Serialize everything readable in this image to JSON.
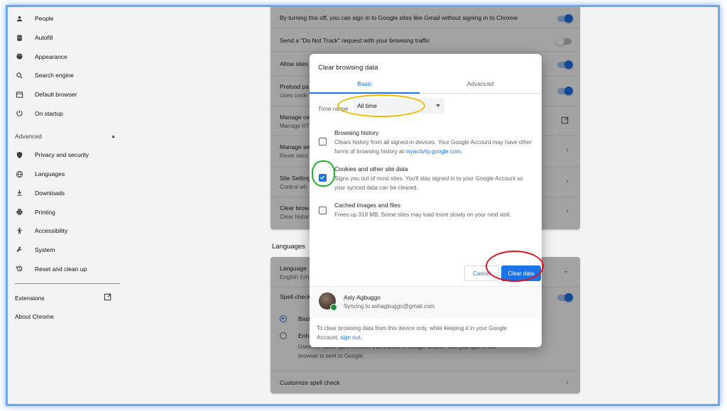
{
  "sidebar": {
    "items": [
      {
        "label": "People",
        "icon": "person-icon"
      },
      {
        "label": "Autofill",
        "icon": "clipboard-icon"
      },
      {
        "label": "Appearance",
        "icon": "palette-icon"
      },
      {
        "label": "Search engine",
        "icon": "search-icon"
      },
      {
        "label": "Default browser",
        "icon": "browser-icon"
      },
      {
        "label": "On startup",
        "icon": "power-icon"
      }
    ],
    "advanced_label": "Advanced",
    "advanced_items": [
      {
        "label": "Privacy and security",
        "icon": "shield-icon"
      },
      {
        "label": "Languages",
        "icon": "globe-icon"
      },
      {
        "label": "Downloads",
        "icon": "download-icon"
      },
      {
        "label": "Printing",
        "icon": "printer-icon"
      },
      {
        "label": "Accessibility",
        "icon": "accessibility-icon"
      },
      {
        "label": "System",
        "icon": "wrench-icon"
      },
      {
        "label": "Reset and clean up",
        "icon": "history-icon"
      }
    ],
    "extensions_label": "Extensions",
    "about_label": "About Chrome"
  },
  "privacy_card": {
    "rows": [
      {
        "title": "By turning this off, you can sign in to Google sites like Gmail without signing in to Chrome",
        "sub": ""
      },
      {
        "title": "Send a \"Do Not Track\" request with your browsing traffic",
        "sub": ""
      },
      {
        "title": "Allow sites",
        "sub": ""
      },
      {
        "title": "Preload pa",
        "sub": "Uses cooki"
      },
      {
        "title": "Manage ce",
        "sub": "Manage HT"
      },
      {
        "title": "Manage se",
        "sub": "Reset secu"
      },
      {
        "title": "Site Setting",
        "sub": "Control wh"
      },
      {
        "title": "Clear brow",
        "sub": "Clear histor"
      }
    ]
  },
  "languages_section": {
    "title": "Languages",
    "language_row": {
      "title": "Language",
      "sub": "English (Un"
    },
    "spell_row": {
      "title": "Spell check"
    },
    "basic_label": "Basi",
    "enhanced_label": "Enh",
    "enhanced_desc": "Uses the same spell checker that's used in Google search. Text you type in the browser is sent to Google.",
    "customize_label": "Customize spell check"
  },
  "dialog": {
    "title": "Clear browsing data",
    "tabs": {
      "basic": "Basic",
      "advanced": "Advanced"
    },
    "time_range_label": "Time range",
    "time_range_value": "All time",
    "options": {
      "history": {
        "title": "Browsing history",
        "desc": "Clears history from all signed-in devices. Your Google Account may have other forms of browsing history at",
        "link": "myactivity.google.com",
        "tail": ".",
        "checked": false
      },
      "cookies": {
        "title": "Cookies and other site data",
        "desc": "Signs you out of most sites. You'll stay signed in to your Google Account so your synced data can be cleared.",
        "checked": true
      },
      "cache": {
        "title": "Cached images and files",
        "desc": "Frees up 318 MB. Some sites may load more slowly on your next visit.",
        "checked": false
      }
    },
    "cancel_label": "Cancel",
    "clear_label": "Clear data",
    "account": {
      "name": "Asly Agbuggo",
      "sync_status": "Syncing to ashagbuggo@gmail.com"
    },
    "footer": {
      "text": "To clear browsing data from this device only, while keeping it in your Google Account,",
      "link": "sign out",
      "tail": "."
    }
  },
  "colors": {
    "accent": "#1a73e8",
    "annotation_yellow": "#f5b800",
    "annotation_green": "#1eb428",
    "annotation_red": "#e0141e",
    "frame_border": "#6ea6ea"
  }
}
